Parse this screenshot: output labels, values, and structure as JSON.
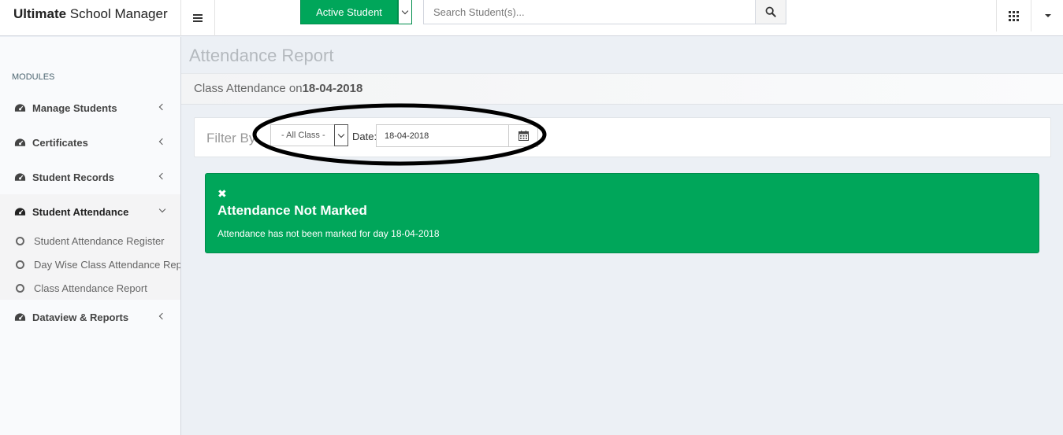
{
  "app": {
    "brand_bold": "Ultimate",
    "brand_rest": " School Manager"
  },
  "topbar": {
    "active_student_label": "Active Student",
    "search_placeholder": "Search Student(s)..."
  },
  "sidebar": {
    "modules_header": "MODULES",
    "items": [
      {
        "label": "Manage Students",
        "expanded": false
      },
      {
        "label": "Certificates",
        "expanded": false
      },
      {
        "label": "Student Records",
        "expanded": false
      },
      {
        "label": "Student Attendance",
        "expanded": true
      },
      {
        "label": "Dataview & Reports",
        "expanded": false
      }
    ],
    "attendance_submenu": [
      {
        "label": "Student Attendance Register"
      },
      {
        "label": "Day Wise Class Attendance Report"
      },
      {
        "label": "Class Attendance Report"
      }
    ]
  },
  "main": {
    "page_title": "Attendance Report",
    "subheader_prefix": "Class Attendance on",
    "subheader_date": "18-04-2018",
    "filter": {
      "label": "Filter By",
      "class_value": "- All Class -",
      "date_label": "Date:",
      "date_value": "18-04-2018"
    },
    "alert": {
      "close_glyph": "✖",
      "title": "Attendance Not Marked",
      "message": "Attendance has not been marked for day 18-04-2018",
      "color": "#00a65a"
    }
  },
  "colors": {
    "accent_green": "#00a65a",
    "background": "#ecf0f5",
    "sidebar_bg": "#f9fafc"
  }
}
